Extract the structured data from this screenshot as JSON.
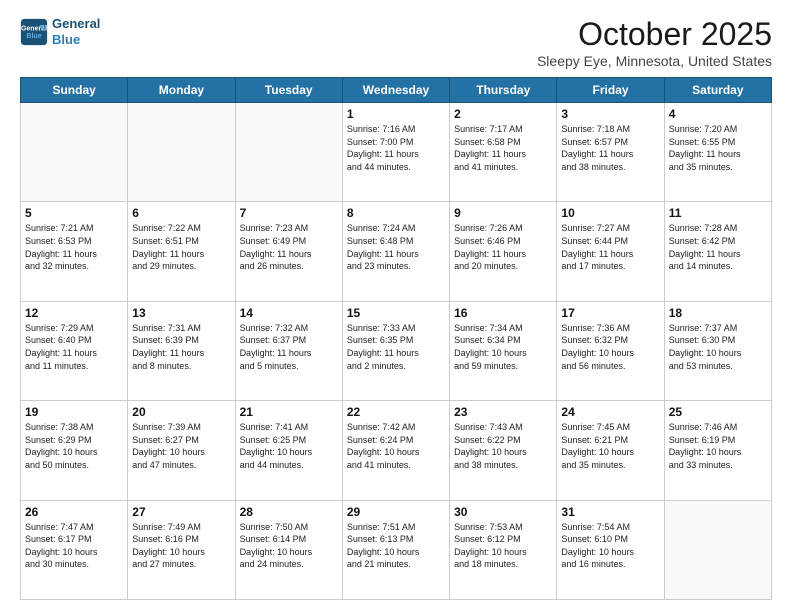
{
  "logo": {
    "line1": "General",
    "line2": "Blue"
  },
  "header": {
    "month": "October 2025",
    "location": "Sleepy Eye, Minnesota, United States"
  },
  "weekdays": [
    "Sunday",
    "Monday",
    "Tuesday",
    "Wednesday",
    "Thursday",
    "Friday",
    "Saturday"
  ],
  "weeks": [
    [
      {
        "day": "",
        "info": ""
      },
      {
        "day": "",
        "info": ""
      },
      {
        "day": "",
        "info": ""
      },
      {
        "day": "1",
        "info": "Sunrise: 7:16 AM\nSunset: 7:00 PM\nDaylight: 11 hours\nand 44 minutes."
      },
      {
        "day": "2",
        "info": "Sunrise: 7:17 AM\nSunset: 6:58 PM\nDaylight: 11 hours\nand 41 minutes."
      },
      {
        "day": "3",
        "info": "Sunrise: 7:18 AM\nSunset: 6:57 PM\nDaylight: 11 hours\nand 38 minutes."
      },
      {
        "day": "4",
        "info": "Sunrise: 7:20 AM\nSunset: 6:55 PM\nDaylight: 11 hours\nand 35 minutes."
      }
    ],
    [
      {
        "day": "5",
        "info": "Sunrise: 7:21 AM\nSunset: 6:53 PM\nDaylight: 11 hours\nand 32 minutes."
      },
      {
        "day": "6",
        "info": "Sunrise: 7:22 AM\nSunset: 6:51 PM\nDaylight: 11 hours\nand 29 minutes."
      },
      {
        "day": "7",
        "info": "Sunrise: 7:23 AM\nSunset: 6:49 PM\nDaylight: 11 hours\nand 26 minutes."
      },
      {
        "day": "8",
        "info": "Sunrise: 7:24 AM\nSunset: 6:48 PM\nDaylight: 11 hours\nand 23 minutes."
      },
      {
        "day": "9",
        "info": "Sunrise: 7:26 AM\nSunset: 6:46 PM\nDaylight: 11 hours\nand 20 minutes."
      },
      {
        "day": "10",
        "info": "Sunrise: 7:27 AM\nSunset: 6:44 PM\nDaylight: 11 hours\nand 17 minutes."
      },
      {
        "day": "11",
        "info": "Sunrise: 7:28 AM\nSunset: 6:42 PM\nDaylight: 11 hours\nand 14 minutes."
      }
    ],
    [
      {
        "day": "12",
        "info": "Sunrise: 7:29 AM\nSunset: 6:40 PM\nDaylight: 11 hours\nand 11 minutes."
      },
      {
        "day": "13",
        "info": "Sunrise: 7:31 AM\nSunset: 6:39 PM\nDaylight: 11 hours\nand 8 minutes."
      },
      {
        "day": "14",
        "info": "Sunrise: 7:32 AM\nSunset: 6:37 PM\nDaylight: 11 hours\nand 5 minutes."
      },
      {
        "day": "15",
        "info": "Sunrise: 7:33 AM\nSunset: 6:35 PM\nDaylight: 11 hours\nand 2 minutes."
      },
      {
        "day": "16",
        "info": "Sunrise: 7:34 AM\nSunset: 6:34 PM\nDaylight: 10 hours\nand 59 minutes."
      },
      {
        "day": "17",
        "info": "Sunrise: 7:36 AM\nSunset: 6:32 PM\nDaylight: 10 hours\nand 56 minutes."
      },
      {
        "day": "18",
        "info": "Sunrise: 7:37 AM\nSunset: 6:30 PM\nDaylight: 10 hours\nand 53 minutes."
      }
    ],
    [
      {
        "day": "19",
        "info": "Sunrise: 7:38 AM\nSunset: 6:29 PM\nDaylight: 10 hours\nand 50 minutes."
      },
      {
        "day": "20",
        "info": "Sunrise: 7:39 AM\nSunset: 6:27 PM\nDaylight: 10 hours\nand 47 minutes."
      },
      {
        "day": "21",
        "info": "Sunrise: 7:41 AM\nSunset: 6:25 PM\nDaylight: 10 hours\nand 44 minutes."
      },
      {
        "day": "22",
        "info": "Sunrise: 7:42 AM\nSunset: 6:24 PM\nDaylight: 10 hours\nand 41 minutes."
      },
      {
        "day": "23",
        "info": "Sunrise: 7:43 AM\nSunset: 6:22 PM\nDaylight: 10 hours\nand 38 minutes."
      },
      {
        "day": "24",
        "info": "Sunrise: 7:45 AM\nSunset: 6:21 PM\nDaylight: 10 hours\nand 35 minutes."
      },
      {
        "day": "25",
        "info": "Sunrise: 7:46 AM\nSunset: 6:19 PM\nDaylight: 10 hours\nand 33 minutes."
      }
    ],
    [
      {
        "day": "26",
        "info": "Sunrise: 7:47 AM\nSunset: 6:17 PM\nDaylight: 10 hours\nand 30 minutes."
      },
      {
        "day": "27",
        "info": "Sunrise: 7:49 AM\nSunset: 6:16 PM\nDaylight: 10 hours\nand 27 minutes."
      },
      {
        "day": "28",
        "info": "Sunrise: 7:50 AM\nSunset: 6:14 PM\nDaylight: 10 hours\nand 24 minutes."
      },
      {
        "day": "29",
        "info": "Sunrise: 7:51 AM\nSunset: 6:13 PM\nDaylight: 10 hours\nand 21 minutes."
      },
      {
        "day": "30",
        "info": "Sunrise: 7:53 AM\nSunset: 6:12 PM\nDaylight: 10 hours\nand 18 minutes."
      },
      {
        "day": "31",
        "info": "Sunrise: 7:54 AM\nSunset: 6:10 PM\nDaylight: 10 hours\nand 16 minutes."
      },
      {
        "day": "",
        "info": ""
      }
    ]
  ]
}
